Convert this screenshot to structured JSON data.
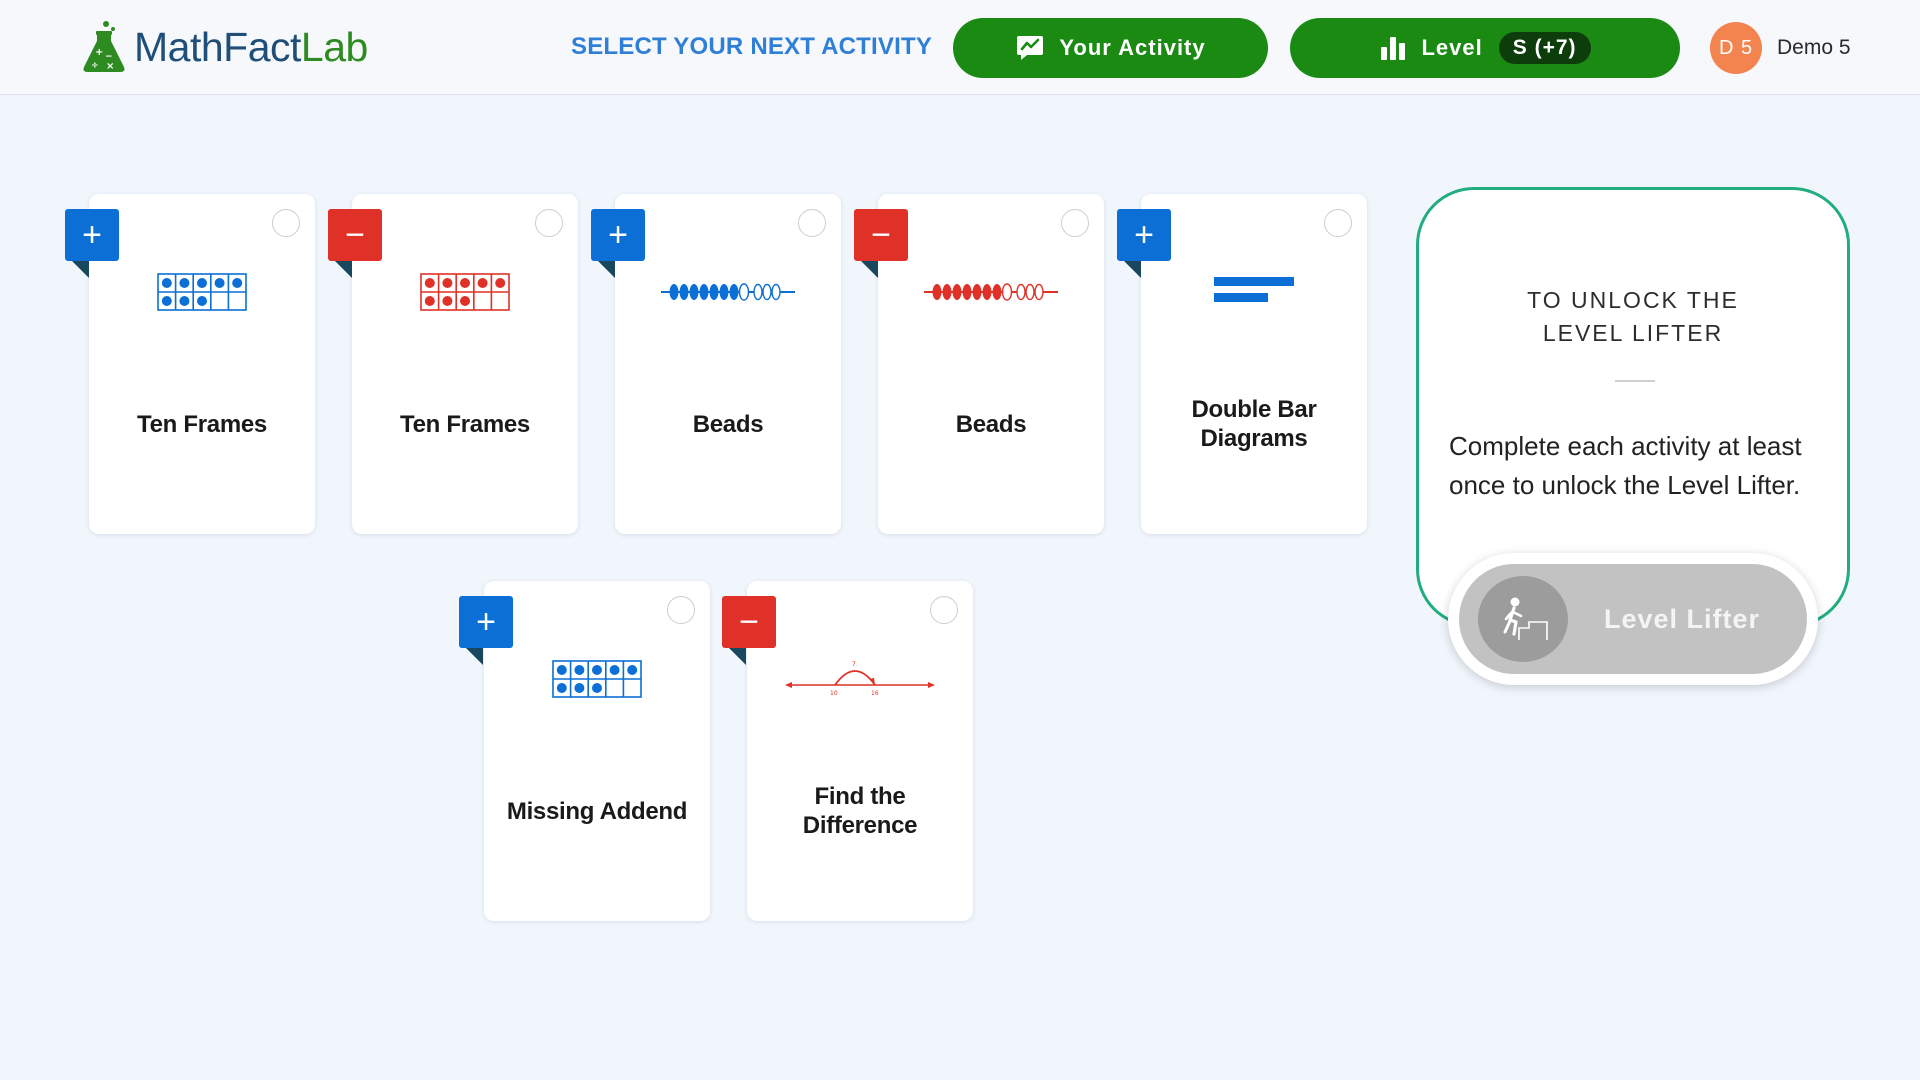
{
  "header": {
    "logo_math": "MathFact",
    "logo_lab": "Lab",
    "select_label": "SELECT YOUR NEXT ACTIVITY",
    "activity_label": "Your Activity",
    "level_label": "Level",
    "level_value": "S (+7)",
    "avatar_initials": "D 5",
    "username": "Demo 5"
  },
  "cards": [
    {
      "title": "Ten Frames",
      "operation": "plus",
      "icon": "ten-frame-icon"
    },
    {
      "title": "Ten Frames",
      "operation": "minus",
      "icon": "ten-frame-icon"
    },
    {
      "title": "Beads",
      "operation": "plus",
      "icon": "beads-icon"
    },
    {
      "title": "Beads",
      "operation": "minus",
      "icon": "beads-icon"
    },
    {
      "title": "Double Bar Diagrams",
      "operation": "plus",
      "icon": "bar-diagram-icon"
    },
    {
      "title": "Missing Addend",
      "operation": "plus",
      "icon": "ten-frame-icon"
    },
    {
      "title": "Find the Difference",
      "operation": "minus",
      "icon": "number-line-icon",
      "number_line_labels": [
        "7",
        "10",
        "16"
      ]
    }
  ],
  "unlock": {
    "title_line1": "TO UNLOCK THE",
    "title_line2": "LEVEL LIFTER",
    "text": "Complete each activity at least once to unlock the Level Lifter.",
    "button_label": "Level Lifter"
  },
  "colors": {
    "plus": "#0b6fd6",
    "minus": "#df3127",
    "green": "#1a8a13",
    "panel_border": "#22ad80"
  }
}
